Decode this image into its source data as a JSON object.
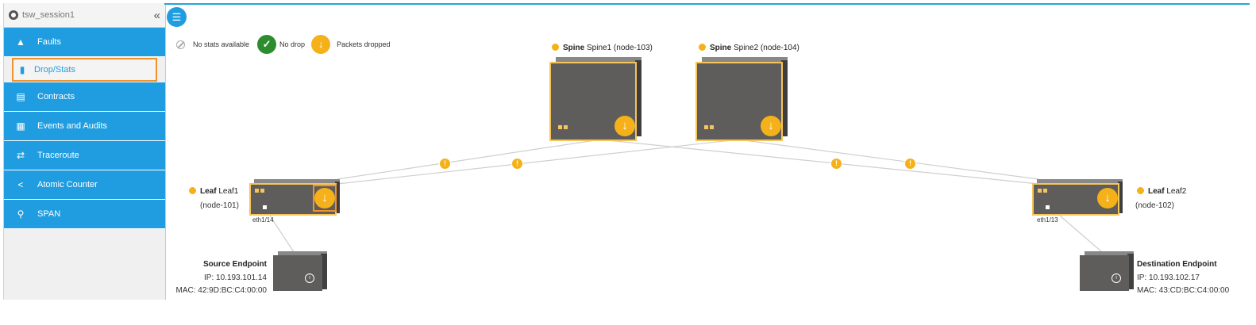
{
  "session": {
    "name": "tsw_session1",
    "collapse_icon": "double-chevron-left-icon"
  },
  "nav": [
    {
      "id": "faults",
      "label": "Faults",
      "icon": "warning-icon"
    },
    {
      "id": "dropstats",
      "label": "Drop/Stats",
      "icon": "bar-chart-icon",
      "active": true
    },
    {
      "id": "contracts",
      "label": "Contracts",
      "icon": "contract-icon"
    },
    {
      "id": "events",
      "label": "Events and Audits",
      "icon": "events-icon"
    },
    {
      "id": "traceroute",
      "label": "Traceroute",
      "icon": "traceroute-icon"
    },
    {
      "id": "atomic",
      "label": "Atomic Counter",
      "icon": "share-icon"
    },
    {
      "id": "span",
      "label": "SPAN",
      "icon": "span-icon"
    }
  ],
  "legend": {
    "no_stats": "No stats available",
    "no_drop": "No drop",
    "packets_dropped": "Packets dropped"
  },
  "spine1": {
    "role": "Spine",
    "name": "Spine1 (node-103)"
  },
  "spine2": {
    "role": "Spine",
    "name": "Spine2 (node-104)"
  },
  "leaf1": {
    "role": "Leaf",
    "name": "Leaf1",
    "node": "(node-101)",
    "port": "eth1/14"
  },
  "leaf2": {
    "role": "Leaf",
    "name": "Leaf2",
    "node": "(node-102)",
    "port": "eth1/13"
  },
  "source": {
    "title": "Source Endpoint",
    "ip": "IP: 10.193.101.14",
    "mac": "MAC: 42:9D:BC:C4:00:00"
  },
  "destination": {
    "title": "Destination Endpoint",
    "ip": "IP: 10.193.102.17",
    "mac": "MAC: 43:CD:BC:C4:00:00"
  },
  "colors": {
    "accent": "#1f9de0",
    "highlight": "#f0922e",
    "warning": "#f5b11a",
    "ok": "#2d8c2d"
  }
}
